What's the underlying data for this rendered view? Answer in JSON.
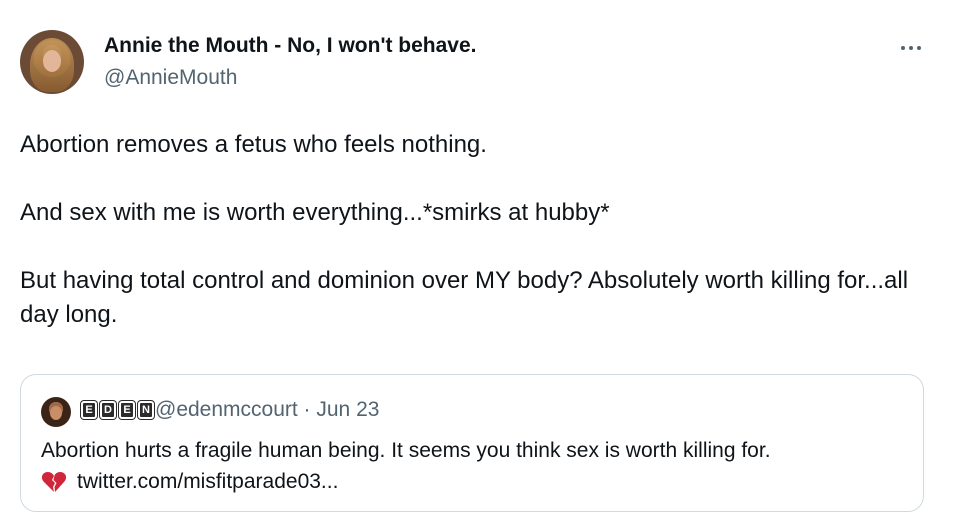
{
  "author": {
    "display_name": "Annie the Mouth - No, I won't behave.",
    "handle": "@AnnieMouth"
  },
  "tweet": {
    "text": "Abortion removes a fetus who feels nothing.\n\nAnd sex with me is worth everything...*smirks at hubby*\n\nBut having total control and dominion over MY body? Absolutely worth killing for...all day long."
  },
  "quoted": {
    "name_badge": [
      "E",
      "D",
      "E",
      "N"
    ],
    "meta": "@edenmccourt · Jun 23",
    "text_line1": "Abortion hurts a fragile human being. It seems you think sex is worth killing for.",
    "link": "twitter.com/misfitparade03...",
    "heart_icon": "broken-heart-icon"
  },
  "icons": {
    "more": "more-options-icon"
  }
}
